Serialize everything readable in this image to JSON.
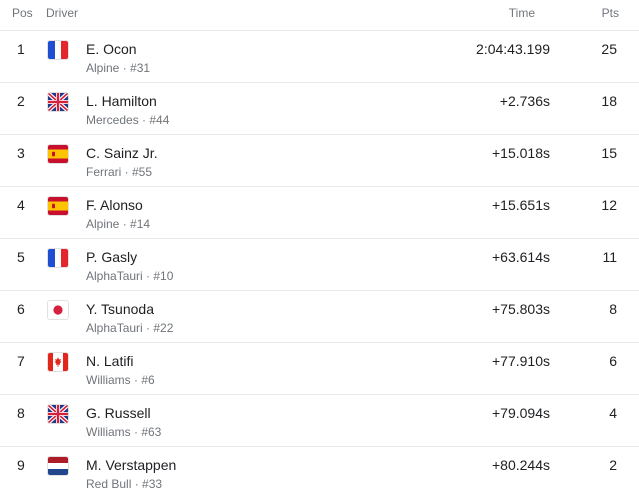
{
  "header": {
    "pos": "Pos",
    "driver": "Driver",
    "time": "Time",
    "pts": "Pts"
  },
  "rows": [
    {
      "pos": "1",
      "flag": "fr-flag-icon",
      "name": "E. Ocon",
      "team": "Alpine · #31",
      "time": "2:04:43.199",
      "pts": "25"
    },
    {
      "pos": "2",
      "flag": "gb-flag-icon",
      "name": "L. Hamilton",
      "team": "Mercedes · #44",
      "time": "+2.736s",
      "pts": "18"
    },
    {
      "pos": "3",
      "flag": "es-flag-icon",
      "name": "C. Sainz Jr.",
      "team": "Ferrari · #55",
      "time": "+15.018s",
      "pts": "15"
    },
    {
      "pos": "4",
      "flag": "es-flag-icon",
      "name": "F. Alonso",
      "team": "Alpine · #14",
      "time": "+15.651s",
      "pts": "12"
    },
    {
      "pos": "5",
      "flag": "fr-flag-icon",
      "name": "P. Gasly",
      "team": "AlphaTauri · #10",
      "time": "+63.614s",
      "pts": "11"
    },
    {
      "pos": "6",
      "flag": "jp-flag-icon",
      "name": "Y. Tsunoda",
      "team": "AlphaTauri · #22",
      "time": "+75.803s",
      "pts": "8"
    },
    {
      "pos": "7",
      "flag": "ca-flag-icon",
      "name": "N. Latifi",
      "team": "Williams · #6",
      "time": "+77.910s",
      "pts": "6"
    },
    {
      "pos": "8",
      "flag": "gb-flag-icon",
      "name": "G. Russell",
      "team": "Williams · #63",
      "time": "+79.094s",
      "pts": "4"
    },
    {
      "pos": "9",
      "flag": "nl-flag-icon",
      "name": "M. Verstappen",
      "team": "Red Bull · #33",
      "time": "+80.244s",
      "pts": "2"
    }
  ]
}
